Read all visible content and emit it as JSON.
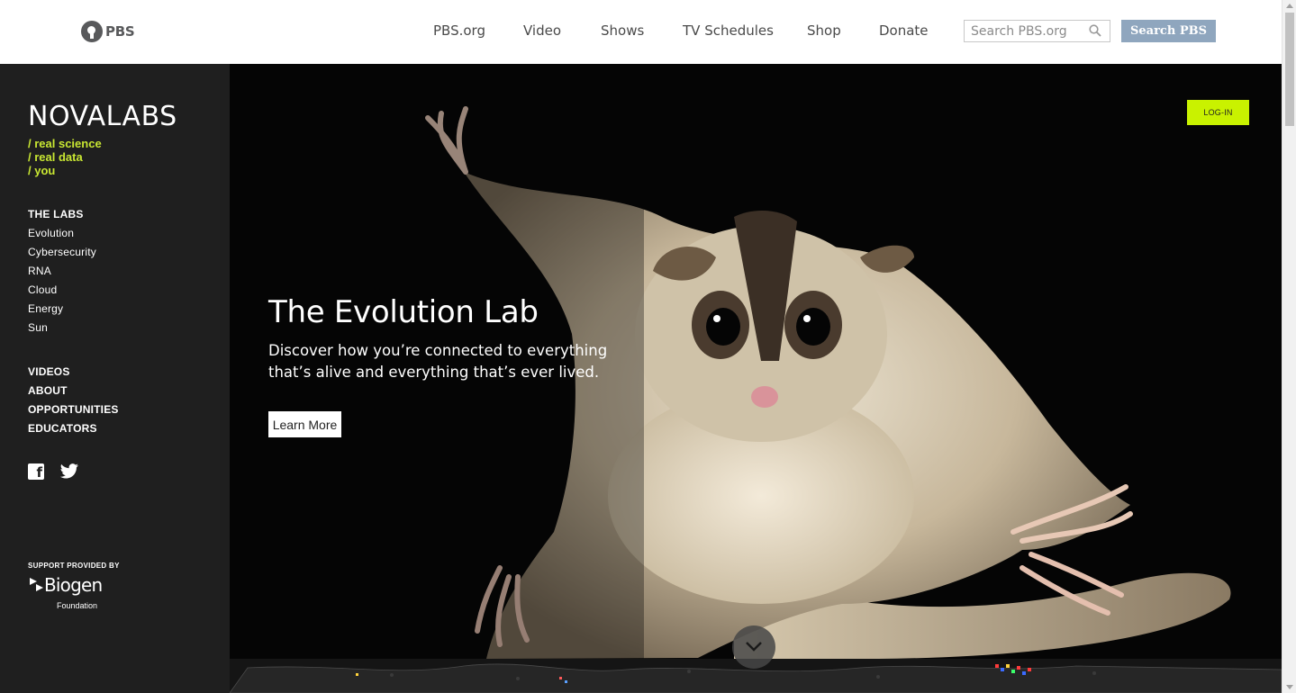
{
  "pbs_header": {
    "logo_text": "PBS",
    "nav": [
      "PBS.org",
      "Video",
      "Shows",
      "TV Schedules",
      "Shop",
      "Donate"
    ],
    "search_placeholder": "Search PBS.org",
    "search_button": "Search PBS"
  },
  "sidebar": {
    "logo": "NOVALABS",
    "tagline": [
      "/ real science",
      "/ real data",
      "/ you"
    ],
    "labs_heading": "THE LABS",
    "labs": [
      "Evolution",
      "Cybersecurity",
      "RNA",
      "Cloud",
      "Energy",
      "Sun"
    ],
    "secondary": [
      "VIDEOS",
      "ABOUT",
      "OPPORTUNITIES",
      "EDUCATORS"
    ],
    "social_icons": [
      "facebook-icon",
      "twitter-icon"
    ],
    "support_label": "SUPPORT PROVIDED BY",
    "sponsor_name": "Biogen",
    "sponsor_sub": "Foundation"
  },
  "hero": {
    "login": "LOG-IN",
    "title": "The Evolution Lab",
    "description": "Discover how you’re connected to everything that’s alive and everything that’s ever lived.",
    "cta": "Learn More"
  },
  "colors": {
    "accent": "#c9f200",
    "tagline": "#c8e632",
    "search_button": "#8fa6be",
    "sidebar_bg": "#1f1f1f"
  }
}
